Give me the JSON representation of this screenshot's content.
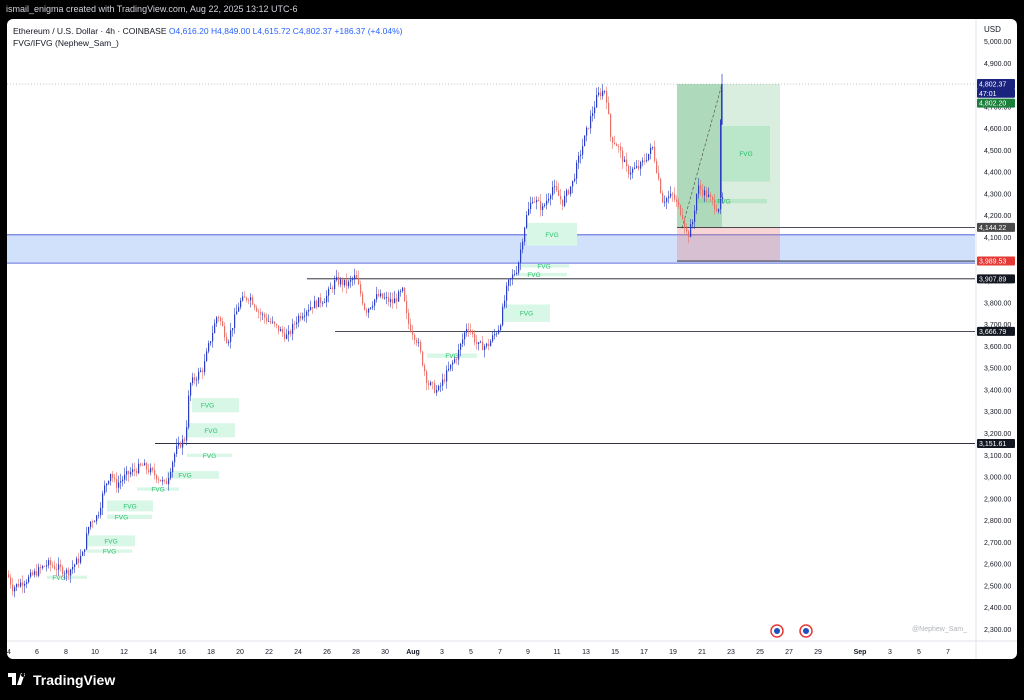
{
  "header": {
    "credit": "ismail_enigma created with TradingView.com, Aug 22, 2025 13:12 UTC-6"
  },
  "legend": {
    "symbol": "Ethereum / U.S. Dollar · 4h · COINBASE",
    "open": "O4,616.20",
    "high": "H4,849.00",
    "low": "L4,615.72",
    "close": "C4,802.37",
    "change": "+186.37 (+4.04%)",
    "indicator": "FVG/IFVG (Nephew_Sam_)"
  },
  "watermark": "@Nephew_Sam_",
  "footer": {
    "brand": "TradingView"
  },
  "colors": {
    "up": "#2a3fc5",
    "down": "#e8726a",
    "fvg": "#d9f7e6",
    "fvg_text": "#26c26b",
    "zone": "#c9dcfa",
    "zone_line": "#3a4bd3"
  },
  "chart_data": {
    "type": "candlestick",
    "symbol": "Ethereum / U.S. Dollar",
    "interval": "4h",
    "currency": "USD",
    "ylim": [
      2300,
      5000
    ],
    "y_ticks": [
      2300,
      2400,
      2500,
      2600,
      2700,
      2800,
      2900,
      3000,
      3100,
      3200,
      3300,
      3400,
      3500,
      3600,
      3700,
      3800,
      3900,
      4000,
      4100,
      4200,
      4300,
      4400,
      4500,
      4600,
      4700,
      4800,
      4900,
      5000
    ],
    "x_ticks": [
      "4",
      "6",
      "8",
      "10",
      "12",
      "14",
      "16",
      "18",
      "20",
      "22",
      "24",
      "26",
      "28",
      "30",
      "Aug",
      "3",
      "5",
      "7",
      "9",
      "11",
      "13",
      "15",
      "17",
      "19",
      "21",
      "23",
      "25",
      "27",
      "29",
      "Sep",
      "3",
      "5",
      "7"
    ],
    "price_path": [
      [
        0,
        2550
      ],
      [
        5,
        2490
      ],
      [
        20,
        2530
      ],
      [
        40,
        2600
      ],
      [
        60,
        2560
      ],
      [
        75,
        2640
      ],
      [
        82,
        2790
      ],
      [
        90,
        2820
      ],
      [
        97,
        2950
      ],
      [
        103,
        3020
      ],
      [
        108,
        2960
      ],
      [
        120,
        3010
      ],
      [
        135,
        3050
      ],
      [
        150,
        3000
      ],
      [
        158,
        2960
      ],
      [
        168,
        3120
      ],
      [
        178,
        3180
      ],
      [
        182,
        3420
      ],
      [
        196,
        3500
      ],
      [
        200,
        3580
      ],
      [
        210,
        3750
      ],
      [
        220,
        3620
      ],
      [
        232,
        3800
      ],
      [
        242,
        3830
      ],
      [
        252,
        3750
      ],
      [
        265,
        3700
      ],
      [
        280,
        3640
      ],
      [
        290,
        3730
      ],
      [
        302,
        3780
      ],
      [
        318,
        3820
      ],
      [
        328,
        3900
      ],
      [
        340,
        3880
      ],
      [
        348,
        3920
      ],
      [
        358,
        3760
      ],
      [
        370,
        3830
      ],
      [
        385,
        3800
      ],
      [
        395,
        3850
      ],
      [
        400,
        3710
      ],
      [
        410,
        3620
      ],
      [
        420,
        3430
      ],
      [
        430,
        3390
      ],
      [
        440,
        3480
      ],
      [
        450,
        3560
      ],
      [
        460,
        3700
      ],
      [
        470,
        3600
      ],
      [
        480,
        3600
      ],
      [
        492,
        3690
      ],
      [
        500,
        3880
      ],
      [
        505,
        3920
      ],
      [
        510,
        3960
      ],
      [
        518,
        4180
      ],
      [
        525,
        4280
      ],
      [
        535,
        4230
      ],
      [
        545,
        4330
      ],
      [
        555,
        4260
      ],
      [
        565,
        4350
      ],
      [
        570,
        4440
      ],
      [
        580,
        4600
      ],
      [
        590,
        4750
      ],
      [
        598,
        4780
      ],
      [
        603,
        4560
      ],
      [
        610,
        4520
      ],
      [
        620,
        4400
      ],
      [
        632,
        4420
      ],
      [
        645,
        4510
      ],
      [
        655,
        4270
      ],
      [
        665,
        4290
      ],
      [
        675,
        4200
      ],
      [
        680,
        4100
      ],
      [
        685,
        4170
      ],
      [
        690,
        4330
      ],
      [
        700,
        4290
      ],
      [
        710,
        4230
      ],
      [
        716,
        4280
      ],
      [
        720,
        4640
      ],
      [
        726,
        4849
      ]
    ],
    "horizontal_levels": [
      {
        "price": 4802.37,
        "label": "4,802.37"
      },
      {
        "price": 4144.22,
        "label": "4,144.22"
      },
      {
        "price": 3989.53,
        "label": "3,989.53"
      },
      {
        "price": 3907.89,
        "label": "3,907.89"
      },
      {
        "price": 3666.79,
        "label": "3,666.79"
      },
      {
        "price": 3151.61,
        "label": "3,151.61"
      }
    ],
    "price_tags": [
      {
        "text": "4,802.37",
        "bg": "#1a237e"
      },
      {
        "text": "47:01",
        "bg": "#1a237e"
      },
      {
        "text": "4,802.20",
        "bg": "#1b7e3a"
      }
    ],
    "demand_zone": {
      "top": 4110,
      "bottom": 3980
    },
    "position": {
      "entry": 4144.22,
      "target": 4802.37,
      "stop": 3989.53
    },
    "fvg_zones": [
      {
        "label": "FVG",
        "top": 2545,
        "bottom": 2530
      },
      {
        "label": "FVG",
        "top": 2665,
        "bottom": 2650
      },
      {
        "label": "FVG",
        "top": 2730,
        "bottom": 2680
      },
      {
        "label": "FVG",
        "top": 2825,
        "bottom": 2805
      },
      {
        "label": "FVG",
        "top": 2890,
        "bottom": 2840
      },
      {
        "label": "FVG",
        "top": 2950,
        "bottom": 2935
      },
      {
        "label": "FVG",
        "top": 3025,
        "bottom": 2990
      },
      {
        "label": "FVG",
        "top": 3105,
        "bottom": 3090
      },
      {
        "label": "FVG",
        "top": 3245,
        "bottom": 3180
      },
      {
        "label": "FVG",
        "top": 3360,
        "bottom": 3295
      },
      {
        "label": "FVG",
        "top": 3565,
        "bottom": 3545
      },
      {
        "label": "FVG",
        "top": 3790,
        "bottom": 3710
      },
      {
        "label": "FVG",
        "top": 3935,
        "bottom": 3920
      },
      {
        "label": "FVG",
        "top": 3975,
        "bottom": 3960
      },
      {
        "label": "FVG",
        "top": 4165,
        "bottom": 4060
      },
      {
        "label": "FVG",
        "top": 4275,
        "bottom": 4255
      },
      {
        "label": "FVG",
        "top": 4610,
        "bottom": 4355
      }
    ]
  }
}
